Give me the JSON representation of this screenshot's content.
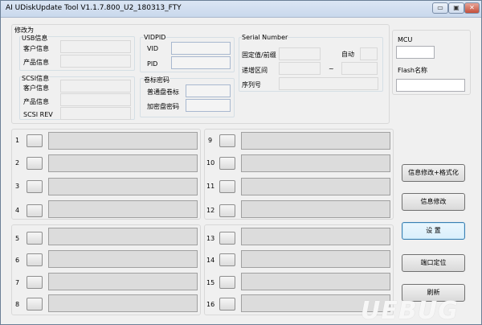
{
  "window": {
    "title": "AI UDiskUpdate Tool V1.1.7.800_U2_180313_FTY"
  },
  "titlebar_buttons": {
    "minimize": "▭",
    "maximize": "▣",
    "close": "✕"
  },
  "modify": {
    "title": "修改为",
    "usb": {
      "title": "USB信息",
      "customer_label": "客户信息",
      "product_label": "产品信息"
    },
    "scsi": {
      "title": "SCSI信息",
      "customer_label": "客户信息",
      "product_label": "产品信息",
      "rev_label": "SCSI REV"
    },
    "vidpid": {
      "title": "VIDPID",
      "vid_label": "VID",
      "pid_label": "PID"
    },
    "volume": {
      "title": "卷标密码",
      "normal_label": "普通盘卷标",
      "encrypted_label": "加密盘密码"
    },
    "serial": {
      "title": "Serial Number",
      "fixed_label": "固定值/前缀",
      "auto_label": "自动",
      "range_label": "递增区间",
      "tilde": "~",
      "serial_label": "序列号"
    }
  },
  "mcu": {
    "title": "MCU",
    "flash_label": "Flash名称"
  },
  "slots": [
    "1",
    "2",
    "3",
    "4",
    "5",
    "6",
    "7",
    "8",
    "9",
    "10",
    "11",
    "12",
    "13",
    "14",
    "15",
    "16"
  ],
  "buttons": {
    "modify_format": "信息修改+格式化",
    "modify_info": "信息修改",
    "settings": "设 置",
    "port_locate": "端口定位",
    "refresh": "刷新"
  },
  "watermark": "UEBUG"
}
